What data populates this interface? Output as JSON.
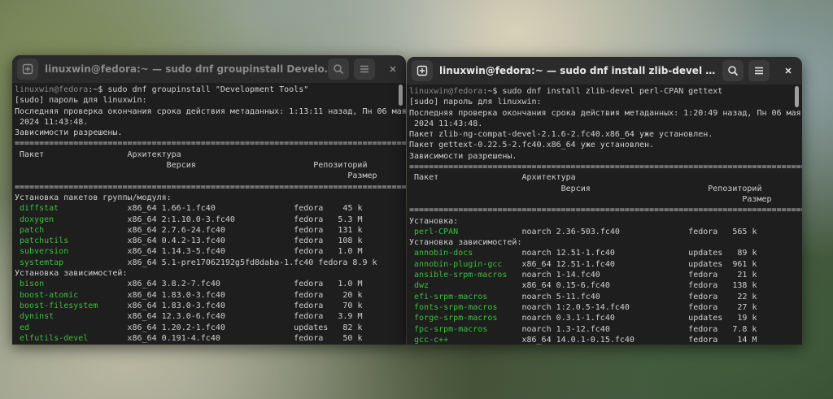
{
  "left": {
    "title": "linuxwin@fedora:~ — sudo dnf groupinstall Development Tools",
    "lines": [
      [
        {
          "t": "linuxwin@fedora",
          "c": "prompt"
        },
        {
          "t": ":~$ sudo dnf groupinstall \"Development Tools\"",
          "c": ""
        }
      ],
      [
        {
          "t": "[sudo] пароль для linuxwin:",
          "c": ""
        }
      ],
      [
        {
          "t": "Последняя проверка окончания срока действия метаданных: 1:13:11 назад, Пн 06 мая",
          "c": ""
        }
      ],
      [
        {
          "t": " 2024 11:43:48.",
          "c": ""
        }
      ],
      [
        {
          "t": "Зависимости разрешены.",
          "c": ""
        }
      ],
      [
        {
          "t": "===================================================================================",
          "c": ""
        }
      ],
      [
        {
          "t": " Пакет                 Архитектура",
          "c": ""
        }
      ],
      [
        {
          "t": "                               Версия                        Репозиторий",
          "c": ""
        }
      ],
      [
        {
          "t": "                                                                    Размер",
          "c": ""
        }
      ],
      [
        {
          "t": "===================================================================================",
          "c": ""
        }
      ],
      [
        {
          "t": "Установка пакетов группы/модуля:",
          "c": ""
        }
      ],
      [
        {
          "t": " diffstat",
          "c": "green"
        },
        {
          "t": "              x86_64 1.66-1.fc40                fedora    45 k",
          "c": ""
        }
      ],
      [
        {
          "t": " doxygen",
          "c": "green"
        },
        {
          "t": "               x86_64 2:1.10.0-3.fc40            fedora   5.3 M",
          "c": ""
        }
      ],
      [
        {
          "t": " patch",
          "c": "green"
        },
        {
          "t": "                 x86_64 2.7.6-24.fc40              fedora   131 k",
          "c": ""
        }
      ],
      [
        {
          "t": " patchutils",
          "c": "green"
        },
        {
          "t": "            x86_64 0.4.2-13.fc40              fedora   108 k",
          "c": ""
        }
      ],
      [
        {
          "t": " subversion",
          "c": "green"
        },
        {
          "t": "            x86_64 1.14.3-5.fc40              fedora   1.0 M",
          "c": ""
        }
      ],
      [
        {
          "t": " systemtap",
          "c": "green"
        },
        {
          "t": "             x86_64 5.1-pre17062192g5fd8daba-1.fc40 fedora 8.9 k",
          "c": ""
        }
      ],
      [
        {
          "t": "Установка зависимостей:",
          "c": ""
        }
      ],
      [
        {
          "t": " bison",
          "c": "green"
        },
        {
          "t": "                 x86_64 3.8.2-7.fc40               fedora   1.0 M",
          "c": ""
        }
      ],
      [
        {
          "t": " boost-atomic",
          "c": "green"
        },
        {
          "t": "          x86_64 1.83.0-3.fc40              fedora    20 k",
          "c": ""
        }
      ],
      [
        {
          "t": " boost-filesystem",
          "c": "green"
        },
        {
          "t": "      x86_64 1.83.0-3.fc40              fedora    70 k",
          "c": ""
        }
      ],
      [
        {
          "t": " dyninst",
          "c": "green"
        },
        {
          "t": "               x86_64 12.3.0-6.fc40              fedora   3.9 M",
          "c": ""
        }
      ],
      [
        {
          "t": " ed",
          "c": "green"
        },
        {
          "t": "                    x86_64 1.20.2-1.fc40              updates   82 k",
          "c": ""
        }
      ],
      [
        {
          "t": " elfutils-devel",
          "c": "green"
        },
        {
          "t": "        x86_64 0.191-4.fc40               fedora    50 k",
          "c": ""
        }
      ]
    ]
  },
  "right": {
    "title": "linuxwin@fedora:~ — sudo dnf install zlib-devel perl-CPAN gett…",
    "lines": [
      [
        {
          "t": "linuxwin@fedora",
          "c": "prompt"
        },
        {
          "t": ":~$ sudo dnf install zlib-devel perl-CPAN gettext",
          "c": ""
        }
      ],
      [
        {
          "t": "[sudo] пароль для linuxwin:",
          "c": ""
        }
      ],
      [
        {
          "t": "Последняя проверка окончания срока действия метаданных: 1:20:49 назад, Пн 06 мая",
          "c": ""
        }
      ],
      [
        {
          "t": " 2024 11:43:48.",
          "c": ""
        }
      ],
      [
        {
          "t": "Пакет zlib-ng-compat-devel-2.1.6-2.fc40.x86_64 уже установлен.",
          "c": ""
        }
      ],
      [
        {
          "t": "Пакет gettext-0.22.5-2.fc40.x86_64 уже установлен.",
          "c": ""
        }
      ],
      [
        {
          "t": "Зависимости разрешены.",
          "c": ""
        }
      ],
      [
        {
          "t": "===================================================================================",
          "c": ""
        }
      ],
      [
        {
          "t": " Пакет                 Архитектура",
          "c": ""
        }
      ],
      [
        {
          "t": "                               Версия                        Репозиторий",
          "c": ""
        }
      ],
      [
        {
          "t": "                                                                    Размер",
          "c": ""
        }
      ],
      [
        {
          "t": "===================================================================================",
          "c": ""
        }
      ],
      [
        {
          "t": "Установка:",
          "c": ""
        }
      ],
      [
        {
          "t": " perl-CPAN",
          "c": "green"
        },
        {
          "t": "             noarch 2.36-503.fc40              fedora   565 k",
          "c": ""
        }
      ],
      [
        {
          "t": "Установка зависимостей:",
          "c": ""
        }
      ],
      [
        {
          "t": " annobin-docs",
          "c": "green"
        },
        {
          "t": "          noarch 12.51-1.fc40               updates   89 k",
          "c": ""
        }
      ],
      [
        {
          "t": " annobin-plugin-gcc",
          "c": "green"
        },
        {
          "t": "    x86_64 12.51-1.fc40               updates  961 k",
          "c": ""
        }
      ],
      [
        {
          "t": " ansible-srpm-macros",
          "c": "green"
        },
        {
          "t": "   noarch 1-14.fc40                  fedora    21 k",
          "c": ""
        }
      ],
      [
        {
          "t": " dwz",
          "c": "green"
        },
        {
          "t": "                   x86_64 0.15-6.fc40                fedora   138 k",
          "c": ""
        }
      ],
      [
        {
          "t": " efi-srpm-macros",
          "c": "green"
        },
        {
          "t": "       noarch 5-11.fc40                  fedora    22 k",
          "c": ""
        }
      ],
      [
        {
          "t": " fonts-srpm-macros",
          "c": "green"
        },
        {
          "t": "     noarch 1:2.0.5-14.fc40            fedora    27 k",
          "c": ""
        }
      ],
      [
        {
          "t": " forge-srpm-macros",
          "c": "green"
        },
        {
          "t": "     noarch 0.3.1-1.fc40               updates   19 k",
          "c": ""
        }
      ],
      [
        {
          "t": " fpc-srpm-macros",
          "c": "green"
        },
        {
          "t": "       noarch 1.3-12.fc40                fedora   7.8 k",
          "c": ""
        }
      ],
      [
        {
          "t": " gcc-c++",
          "c": "green"
        },
        {
          "t": "               x86_64 14.0.1-0.15.fc40           fedora    14 M",
          "c": ""
        }
      ]
    ]
  }
}
